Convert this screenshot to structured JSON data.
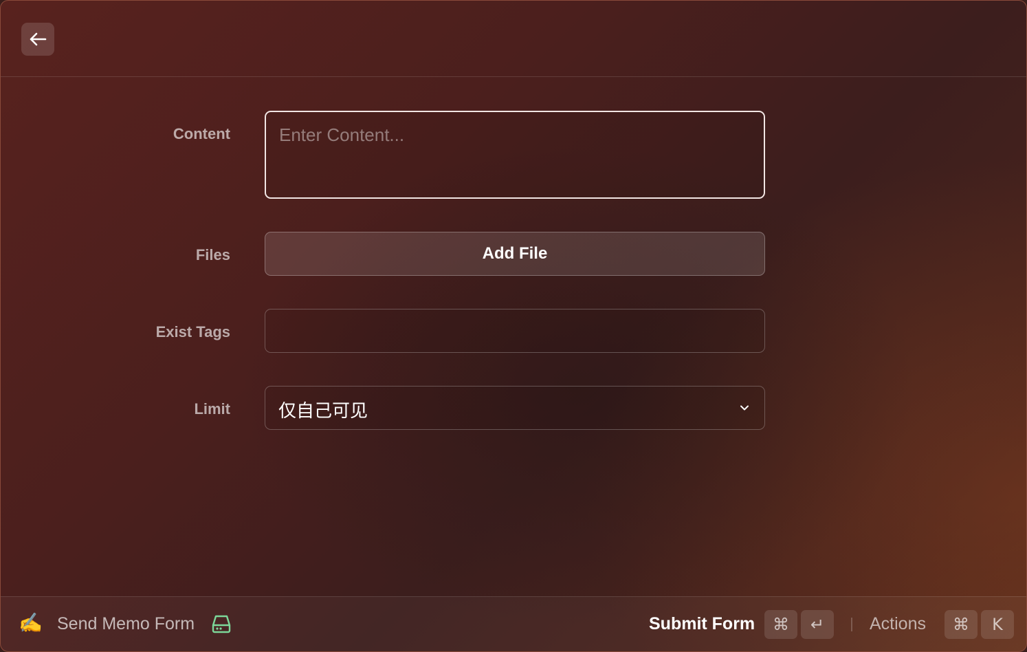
{
  "header": {
    "back_icon": "arrow-left-icon"
  },
  "form": {
    "content": {
      "label": "Content",
      "placeholder": "Enter Content...",
      "value": ""
    },
    "files": {
      "label": "Files",
      "button_label": "Add File"
    },
    "exist_tags": {
      "label": "Exist Tags",
      "value": ""
    },
    "limit": {
      "label": "Limit",
      "selected": "仅自己可见",
      "icon": "chevron-down-icon"
    }
  },
  "footer": {
    "command_icon": "✍️",
    "command_title": "Send Memo Form",
    "status_icon": "hard-drive-icon",
    "status_color": "#7dd89a",
    "primary_action": {
      "label": "Submit Form",
      "shortcut": [
        "⌘",
        "↵"
      ]
    },
    "actions": {
      "label": "Actions",
      "shortcut": [
        "⌘",
        "K"
      ]
    }
  }
}
